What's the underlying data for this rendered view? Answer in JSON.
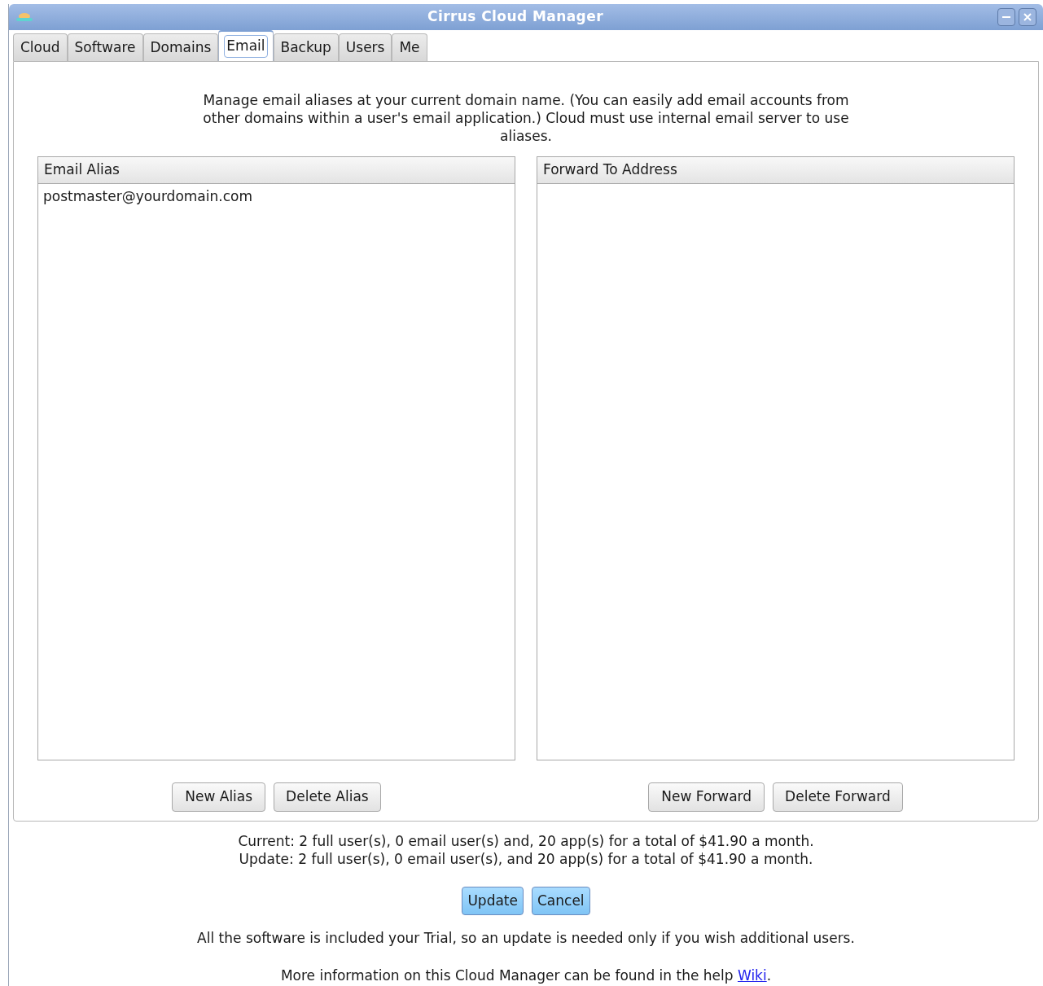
{
  "window": {
    "title": "Cirrus Cloud Manager"
  },
  "tabs": [
    {
      "label": "Cloud",
      "selected": false
    },
    {
      "label": "Software",
      "selected": false
    },
    {
      "label": "Domains",
      "selected": false
    },
    {
      "label": "Email",
      "selected": true
    },
    {
      "label": "Backup",
      "selected": false
    },
    {
      "label": "Users",
      "selected": false
    },
    {
      "label": "Me",
      "selected": false
    }
  ],
  "description": "Manage email aliases at your current domain name. (You can easily add email accounts from other domains within a user's email application.) Cloud must use internal email server to use aliases.",
  "lists": [
    {
      "header": "Email Alias",
      "rows": [
        "postmaster@yourdomain.com"
      ],
      "buttons": [
        "New Alias",
        "Delete Alias"
      ]
    },
    {
      "header": "Forward To Address",
      "buttons": [
        "New Forward",
        "Delete Forward"
      ]
    }
  ],
  "summary": [
    "Current: 2 full user(s), 0 email user(s) and, 20 app(s) for a total of $41.90 a month.",
    "Update: 2 full user(s), 0 email user(s), and 20 app(s) for a total of $41.90 a month."
  ],
  "actions": [
    "Update",
    "Cancel"
  ],
  "note": "All the software is included your Trial, so an update is needed only if you wish additional users.",
  "help": {
    "text": "More information on this Cloud Manager can be found in the help",
    "link": "Wiki",
    "after": "."
  }
}
